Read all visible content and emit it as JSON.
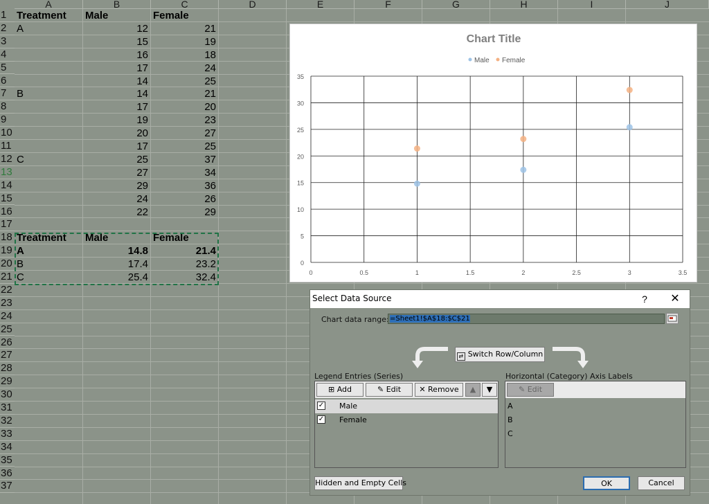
{
  "sheet": {
    "columns": [
      "A",
      "B",
      "C",
      "D",
      "E",
      "F",
      "G",
      "H",
      "I",
      "J"
    ],
    "rows": [
      "1",
      "2",
      "3",
      "4",
      "5",
      "6",
      "7",
      "8",
      "9",
      "10",
      "11",
      "12",
      "13",
      "14",
      "15",
      "16",
      "17",
      "18",
      "19",
      "20",
      "21",
      "22",
      "23",
      "24",
      "25",
      "26",
      "27",
      "28",
      "29",
      "30",
      "31",
      "32",
      "33",
      "34",
      "35",
      "36",
      "37"
    ],
    "active_row": "13",
    "data_rows": [
      {
        "row": 1,
        "a": "Treatment",
        "b": "Male",
        "c": "Female",
        "bold": true,
        "numeric": false
      },
      {
        "row": 2,
        "a": "A",
        "b": "12",
        "c": "21"
      },
      {
        "row": 3,
        "a": "",
        "b": "15",
        "c": "19"
      },
      {
        "row": 4,
        "a": "",
        "b": "16",
        "c": "18"
      },
      {
        "row": 5,
        "a": "",
        "b": "17",
        "c": "24"
      },
      {
        "row": 6,
        "a": "",
        "b": "14",
        "c": "25"
      },
      {
        "row": 7,
        "a": "B",
        "b": "14",
        "c": "21"
      },
      {
        "row": 8,
        "a": "",
        "b": "17",
        "c": "20"
      },
      {
        "row": 9,
        "a": "",
        "b": "19",
        "c": "23"
      },
      {
        "row": 10,
        "a": "",
        "b": "20",
        "c": "27"
      },
      {
        "row": 11,
        "a": "",
        "b": "17",
        "c": "25"
      },
      {
        "row": 12,
        "a": "C",
        "b": "25",
        "c": "37"
      },
      {
        "row": 13,
        "a": "",
        "b": "27",
        "c": "34"
      },
      {
        "row": 14,
        "a": "",
        "b": "29",
        "c": "36"
      },
      {
        "row": 15,
        "a": "",
        "b": "24",
        "c": "26"
      },
      {
        "row": 16,
        "a": "",
        "b": "22",
        "c": "29"
      },
      {
        "row": 18,
        "a": "Treatment",
        "b": "Male",
        "c": "Female",
        "bold": true,
        "numeric": false
      },
      {
        "row": 19,
        "a": "A",
        "b": "14.8",
        "c": "21.4",
        "bold": true
      },
      {
        "row": 20,
        "a": "B",
        "b": "17.4",
        "c": "23.2"
      },
      {
        "row": 21,
        "a": "C",
        "b": "25.4",
        "c": "32.4"
      }
    ]
  },
  "chart_data": {
    "type": "scatter",
    "title": "Chart Title",
    "series": [
      {
        "name": "Male",
        "color": "#9dc3e6",
        "x": [
          1,
          2,
          3
        ],
        "y": [
          14.8,
          17.4,
          25.4
        ]
      },
      {
        "name": "Female",
        "color": "#f4b183",
        "x": [
          1,
          2,
          3
        ],
        "y": [
          21.4,
          23.2,
          32.4
        ]
      }
    ],
    "xlim": [
      0,
      3.5
    ],
    "ylim": [
      0,
      35
    ],
    "x_ticks": [
      "0",
      "0.5",
      "1",
      "1.5",
      "2",
      "2.5",
      "3",
      "3.5"
    ],
    "y_ticks": [
      "0",
      "5",
      "10",
      "15",
      "20",
      "25",
      "30",
      "35"
    ],
    "legend_position": "top",
    "grid": true
  },
  "dialog": {
    "title": "Select Data Source",
    "help": "?",
    "close": "✕",
    "range_label": "Chart data range:",
    "range_value": "=Sheet1!$A$18:$C$21",
    "switch_label": "Switch Row/Column",
    "legend_label": "Legend Entries (Series)",
    "axis_label": "Horizontal (Category) Axis Labels",
    "add_label": "Add",
    "edit_label": "Edit",
    "remove_label": "Remove",
    "axis_edit_label": "Edit",
    "series_items": [
      {
        "label": "Male",
        "checked": true
      },
      {
        "label": "Female",
        "checked": true
      }
    ],
    "category_items": [
      "A",
      "B",
      "C"
    ],
    "hidden_label": "Hidden and Empty Cells",
    "ok_label": "OK",
    "cancel_label": "Cancel"
  }
}
